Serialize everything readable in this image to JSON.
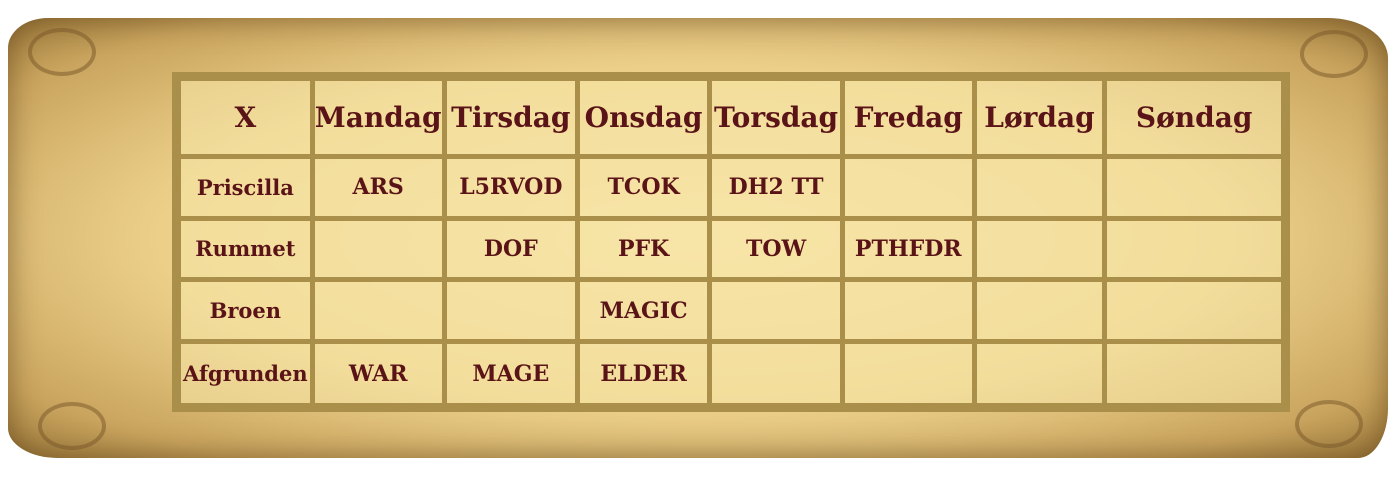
{
  "header": [
    "X",
    "Mandag",
    "Tirsdag",
    "Onsdag",
    "Torsdag",
    "Fredag",
    "Lørdag",
    "Søndag"
  ],
  "rows": [
    {
      "label": "Priscilla",
      "cells": [
        "ARS",
        "L5RVOD",
        "TCOK",
        "DH2 TT",
        "",
        "",
        ""
      ]
    },
    {
      "label": "Rummet",
      "cells": [
        "",
        "DOF",
        "PFK",
        "TOW",
        "PTHFDR",
        "",
        ""
      ]
    },
    {
      "label": "Broen",
      "cells": [
        "",
        "",
        "MAGIC",
        "",
        "",
        "",
        ""
      ]
    },
    {
      "label": "Afgrunden",
      "cells": [
        "WAR",
        "MAGE",
        "ELDER",
        "",
        "",
        "",
        ""
      ]
    }
  ]
}
